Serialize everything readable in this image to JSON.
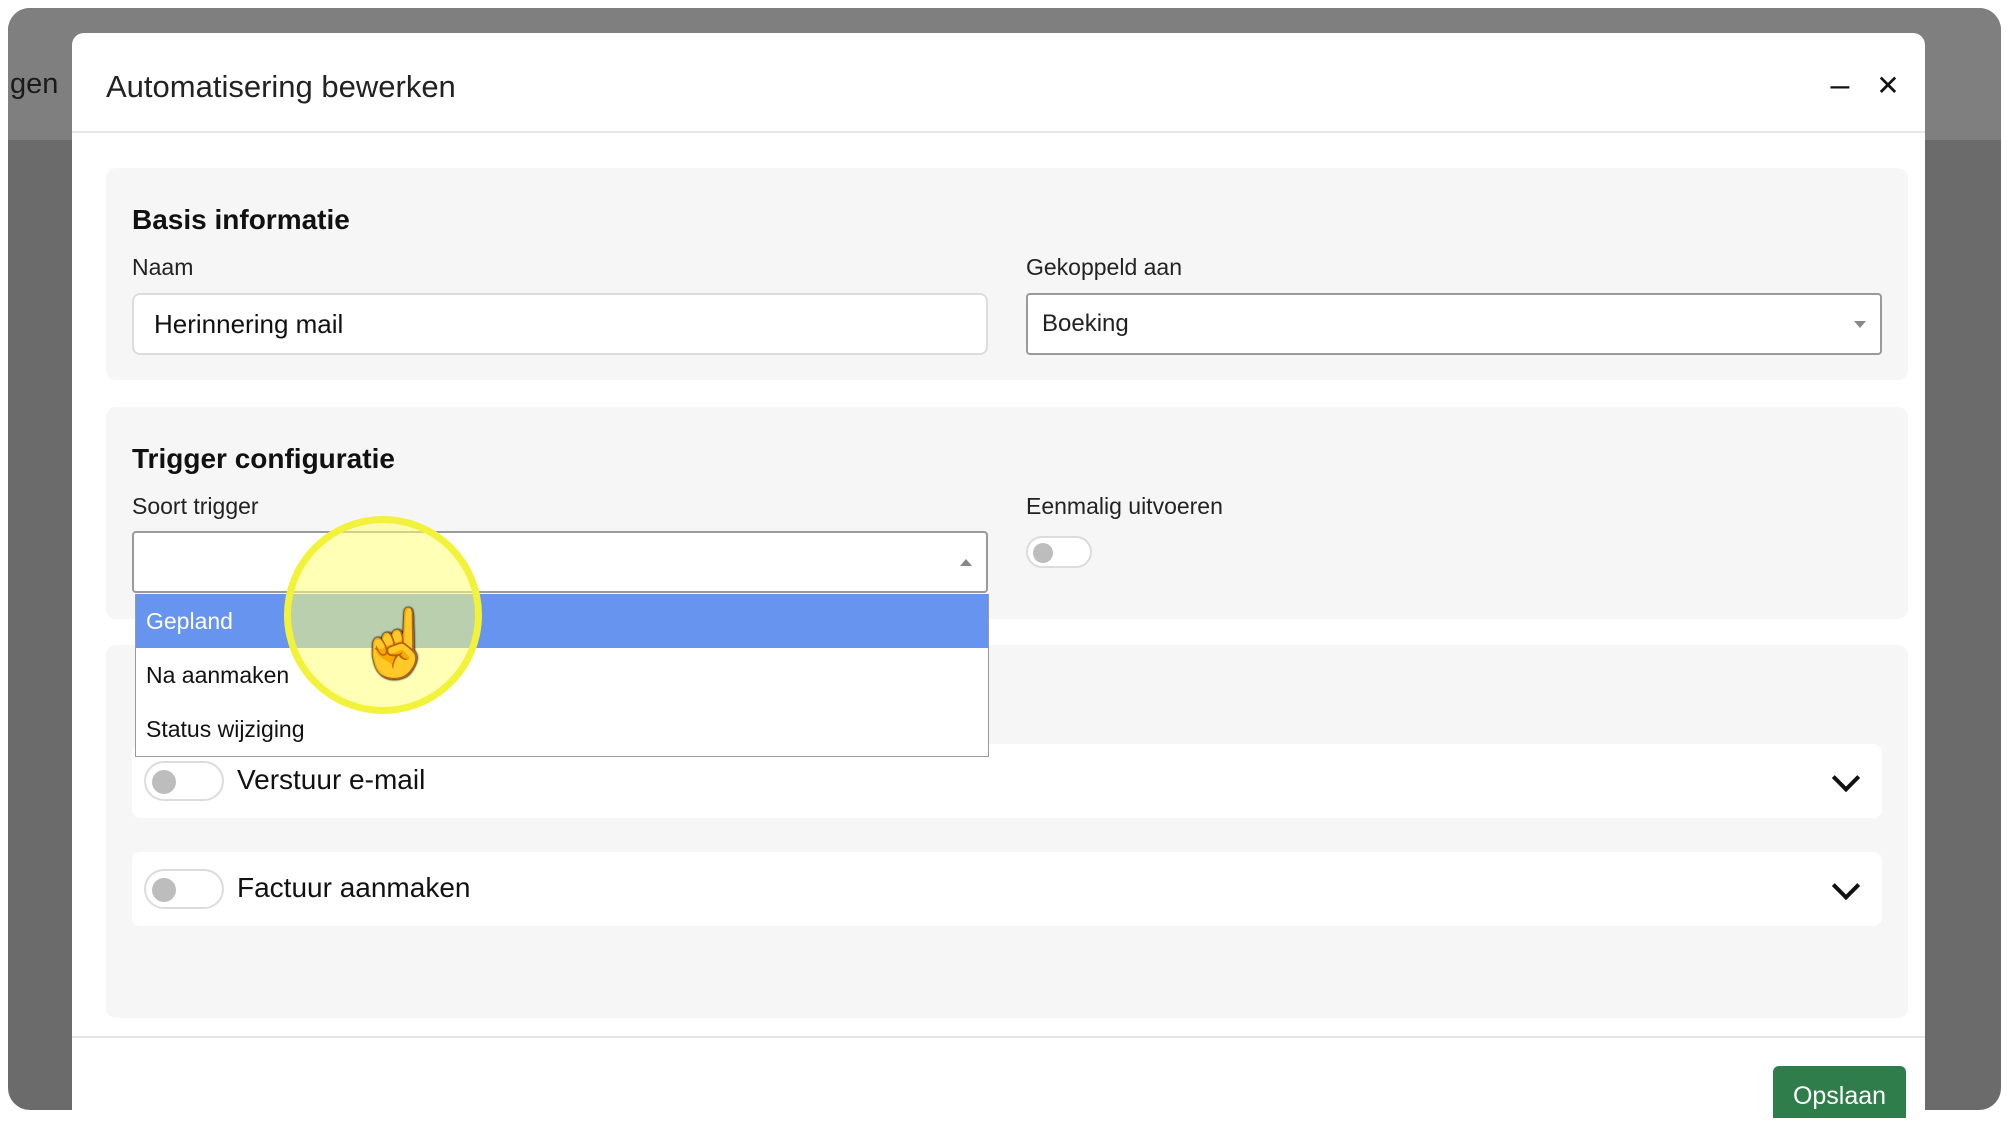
{
  "background": {
    "partial_text": "gen"
  },
  "modal": {
    "title": "Automatisering bewerken",
    "minimize_label": "–",
    "close_label": "✕"
  },
  "basis": {
    "title": "Basis informatie",
    "naam_label": "Naam",
    "naam_value": "Herinnering mail",
    "gekoppeld_label": "Gekoppeld aan",
    "gekoppeld_value": "Boeking"
  },
  "trigger": {
    "title": "Trigger configuratie",
    "soort_label": "Soort trigger",
    "soort_value": "",
    "eenmalig_label": "Eenmalig uitvoeren",
    "eenmalig_on": false,
    "options": [
      "Gepland",
      "Na aanmaken",
      "Status wijziging"
    ],
    "highlighted_option": "Gepland"
  },
  "actions": [
    {
      "label": "Verstuur e-mail",
      "enabled": false
    },
    {
      "label": "Factuur aanmaken",
      "enabled": false
    }
  ],
  "footer": {
    "save_label": "Opslaan"
  },
  "icons": {
    "minimize": "minimize-icon",
    "close": "close-icon",
    "chevron": "chevron-down-icon",
    "cursor": "hand-pointer-icon"
  },
  "colors": {
    "highlight": "#6694ee",
    "save": "#2f7d4a",
    "cursor_halo": "#f2f23a"
  }
}
